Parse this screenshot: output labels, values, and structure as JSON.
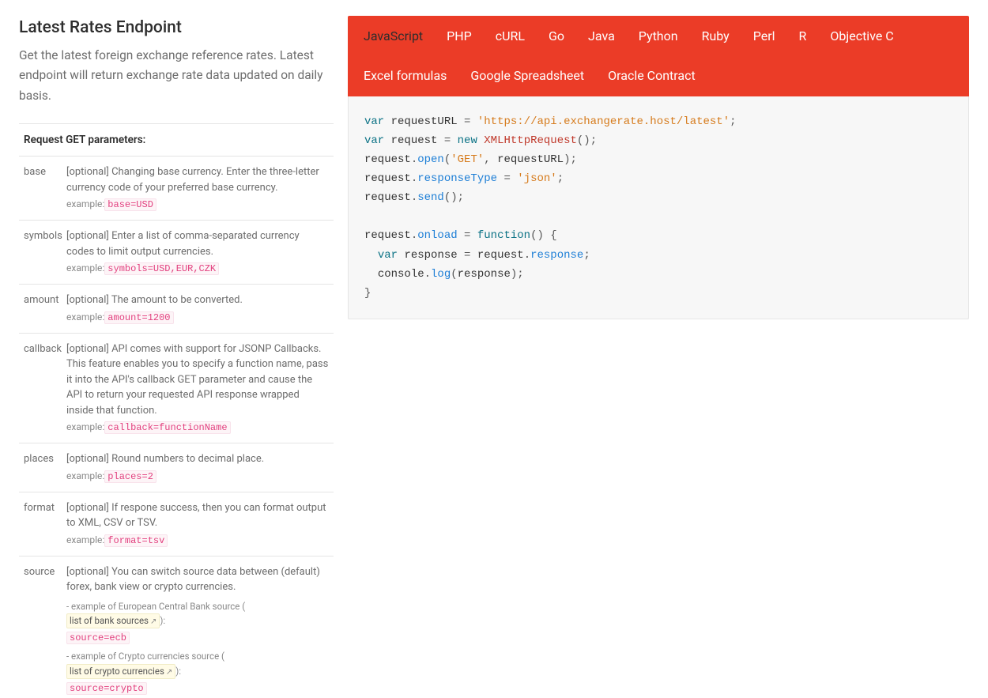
{
  "title": "Latest Rates Endpoint",
  "description": "Get the latest foreign exchange reference rates. Latest endpoint will return exchange rate data updated on daily basis.",
  "params_header": "Request GET parameters:",
  "example_label": "example:",
  "params": [
    {
      "name": "base",
      "desc": "[optional] Changing base currency. Enter the three-letter currency code of your preferred base currency.",
      "example": "base=USD"
    },
    {
      "name": "symbols",
      "desc": "[optional] Enter a list of comma-separated currency codes to limit output currencies.",
      "example": "symbols=USD,EUR,CZK"
    },
    {
      "name": "amount",
      "desc": "[optional] The amount to be converted.",
      "example": "amount=1200"
    },
    {
      "name": "callback",
      "desc": "[optional] API comes with support for JSONP Callbacks. This feature enables you to specify a function name, pass it into the API's callback GET parameter and cause the API to return your requested API response wrapped inside that function.",
      "example": "callback=functionName"
    },
    {
      "name": "places",
      "desc": "[optional] Round numbers to decimal place.",
      "example": "places=2"
    },
    {
      "name": "format",
      "desc": "[optional] If respone success, then you can format output to XML, CSV or TSV.",
      "example": "format=tsv"
    }
  ],
  "source_param": {
    "name": "source",
    "desc": "[optional] You can switch source data between (default) forex, bank view or crypto currencies.",
    "note_bank_pre": "- example of European Central Bank source (",
    "note_bank_link": "list of bank sources",
    "note_bank_post": "):",
    "example_bank": "source=ecb",
    "note_crypto_pre": "- example of Crypto currencies source (",
    "note_crypto_link": "list of crypto currencies",
    "note_crypto_post": "):",
    "example_crypto": "source=crypto"
  },
  "tabs": [
    "JavaScript",
    "PHP",
    "cURL",
    "Go",
    "Java",
    "Python",
    "Ruby",
    "Perl",
    "R",
    "Objective C",
    "Excel formulas",
    "Google Spreadsheet",
    "Oracle Contract"
  ],
  "active_tab": "JavaScript",
  "code": {
    "l1": {
      "kw": "var",
      "id": "requestURL",
      "eq": "=",
      "str": "'https://api.exchangerate.host/latest'",
      "end": ";"
    },
    "l2": {
      "kw": "var",
      "id": "request",
      "eq": "=",
      "kw2": "new",
      "cls": "XMLHttpRequest",
      "par": "()",
      "end": ";"
    },
    "l3": {
      "obj": "request",
      "dot": ".",
      "fn": "open",
      "args_open": "(",
      "str": "'GET'",
      "comma": ", ",
      "id2": "requestURL",
      "args_close": ")",
      "end": ";"
    },
    "l4": {
      "obj": "request",
      "dot": ".",
      "prop": "responseType",
      "eq": " = ",
      "str": "'json'",
      "end": ";"
    },
    "l5": {
      "obj": "request",
      "dot": ".",
      "fn": "send",
      "args": "()",
      "end": ";"
    },
    "l7": {
      "obj": "request",
      "dot": ".",
      "prop": "onload",
      "eq": " = ",
      "kw": "function",
      "args": "()",
      "brace": " {"
    },
    "l8": {
      "indent": "  ",
      "kw": "var",
      "id": "response",
      "eq": " = ",
      "obj": "request",
      "dot": ".",
      "prop": "response",
      "end": ";"
    },
    "l9": {
      "indent": "  ",
      "obj": "console",
      "dot": ".",
      "fn": "log",
      "args_open": "(",
      "id": "response",
      "args_close": ")",
      "end": ";"
    },
    "l10": {
      "brace": "}"
    }
  }
}
